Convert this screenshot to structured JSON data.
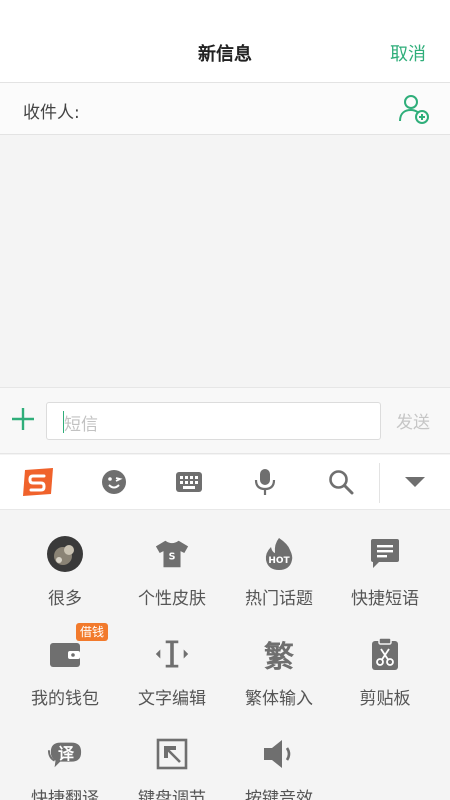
{
  "header": {
    "title": "新信息",
    "cancel": "取消"
  },
  "recipient": {
    "label": "收件人:"
  },
  "compose": {
    "placeholder": "短信",
    "send": "发送"
  },
  "ime_toolbar": {
    "tools": [
      "sogou-logo-icon",
      "emoji-icon",
      "keyboard-icon",
      "microphone-icon",
      "search-icon",
      "collapse-icon"
    ]
  },
  "grid": {
    "badge": "借钱",
    "items": [
      {
        "label": "很多",
        "icon": "avatar-icon"
      },
      {
        "label": "个性皮肤",
        "icon": "tshirt-icon"
      },
      {
        "label": "热门话题",
        "icon": "hot-icon"
      },
      {
        "label": "快捷短语",
        "icon": "message-icon"
      },
      {
        "label": "我的钱包",
        "icon": "wallet-icon"
      },
      {
        "label": "文字编辑",
        "icon": "text-cursor-icon"
      },
      {
        "label": "繁体输入",
        "icon": "traditional-char-icon",
        "glyph": "繁"
      },
      {
        "label": "剪贴板",
        "icon": "clipboard-icon"
      },
      {
        "label": "快捷翻译",
        "icon": "translate-icon",
        "glyph": "译"
      },
      {
        "label": "键盘调节",
        "icon": "keyboard-resize-icon"
      },
      {
        "label": "按键音效",
        "icon": "speaker-icon"
      }
    ]
  },
  "colors": {
    "accent": "#2fae7a",
    "sogou": "#f0622b",
    "icon": "#6f6f6f",
    "badge": "#f27a2c"
  }
}
